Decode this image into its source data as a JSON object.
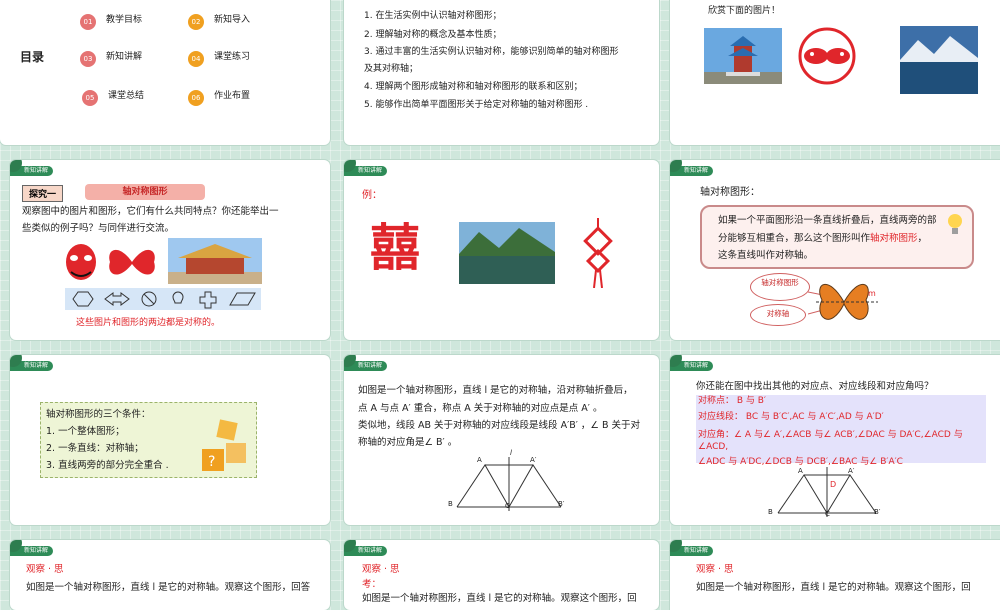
{
  "toc": {
    "title": "目录",
    "items": [
      {
        "num": "01",
        "label": "教学目标",
        "color": "#e57373"
      },
      {
        "num": "02",
        "label": "新知导入",
        "color": "#f0a020"
      },
      {
        "num": "03",
        "label": "新知讲解",
        "color": "#e57373"
      },
      {
        "num": "04",
        "label": "课堂练习",
        "color": "#f0a020"
      },
      {
        "num": "05",
        "label": "课堂总结",
        "color": "#e57373"
      },
      {
        "num": "06",
        "label": "作业布置",
        "color": "#f0a020"
      }
    ]
  },
  "goals": {
    "lines": [
      "1. 在生活实例中认识轴对称图形；",
      "2. 理解轴对称的概念及基本性质；",
      "3. 通过丰富的生活实例认识轴对称，能够识别简单的轴对称图形",
      "及其对称轴；",
      "4. 理解两个图形成轴对称和轴对称图形的联系和区别；",
      "5. 能够作出简单平面图形关于给定对称轴的轴对称图形 ."
    ]
  },
  "intro": {
    "text": "欣赏下面的图片！"
  },
  "tag_label": "新知讲解",
  "explore": {
    "badge": "探究一",
    "banner": "轴对称图形",
    "line1": "观察图中的图片和图形，它们有什么共同特点？你还能举出一",
    "line2": "些类似的例子吗？与同伴进行交流。",
    "conclusion": "这些图片和图形的两边都是对称的。"
  },
  "example": {
    "label": "例：",
    "xi": "囍"
  },
  "definition": {
    "heading": "轴对称图形：",
    "lines": [
      "如果一个平面图形沿一条直线折叠后，直线两旁的部",
      "分能够互相重合，那么这个图形叫作",
      "这条直线叫作",
      "对称轴",
      "。"
    ],
    "term1": "轴对称图形",
    "bubble1": "轴对称图形",
    "bubble2": "对称轴",
    "m": "m"
  },
  "conditions": {
    "title": "轴对称图形的三个条件：",
    "items": [
      "1.  一个整体图形；",
      "2.  一条直线：对称轴；",
      "3.  直线两旁的部分完全重合 ."
    ]
  },
  "property": {
    "lines": [
      "如图是一个轴对称图形，直线 l 是它的对称轴，沿对称轴折叠后，",
      "点 A 与点 A′ 重合，称点 A 关于对称轴的对应点是点 A′ 。",
      "类似地，线段 AB 关于对称轴的对应线段是线段 A′B′ ，∠ B 关于对",
      "称轴的对应角是∠ B′ 。"
    ],
    "labels": {
      "A": "A",
      "A2": "A′",
      "B": "B",
      "B2": "B′",
      "C": "C",
      "l": "l"
    }
  },
  "find": {
    "question": "你还能在图中找出其他的对应点、对应线段和对应角吗？",
    "points": "对称点： B 与 B′",
    "segments": "对应线段： BC 与 B′C′,AC 与 A′C′,AD 与 A′D′",
    "angles1": "对应角：∠ A 与∠ A′,∠ACB 与∠ ACB′,∠DAC 与 DA′C,∠ACD 与",
    "angles2": "∠ACD,",
    "angles3": "∠ADC 与 A′DC,∠DCB 与 DCB′,∠BAC 与∠ B′A′C",
    "labels": {
      "A": "A",
      "A2": "A′",
      "B": "B",
      "B2": "B′",
      "C": "C",
      "D": "D",
      "l": "l"
    }
  },
  "observe": {
    "title": "观察 · 思",
    "title_alt": "观察 · 思",
    "kao": "考：",
    "line": "如图是一个轴对称图形，直线 l 是它的对称轴。观察这个图形，回答",
    "line2": "如图是一个轴对称图形，直线 l 是它的对称轴。观察这个图形，回",
    "line3": "如图是一个轴对称图形，直线 l 是它的对称轴。观察这个图形，回",
    "think": "思"
  }
}
